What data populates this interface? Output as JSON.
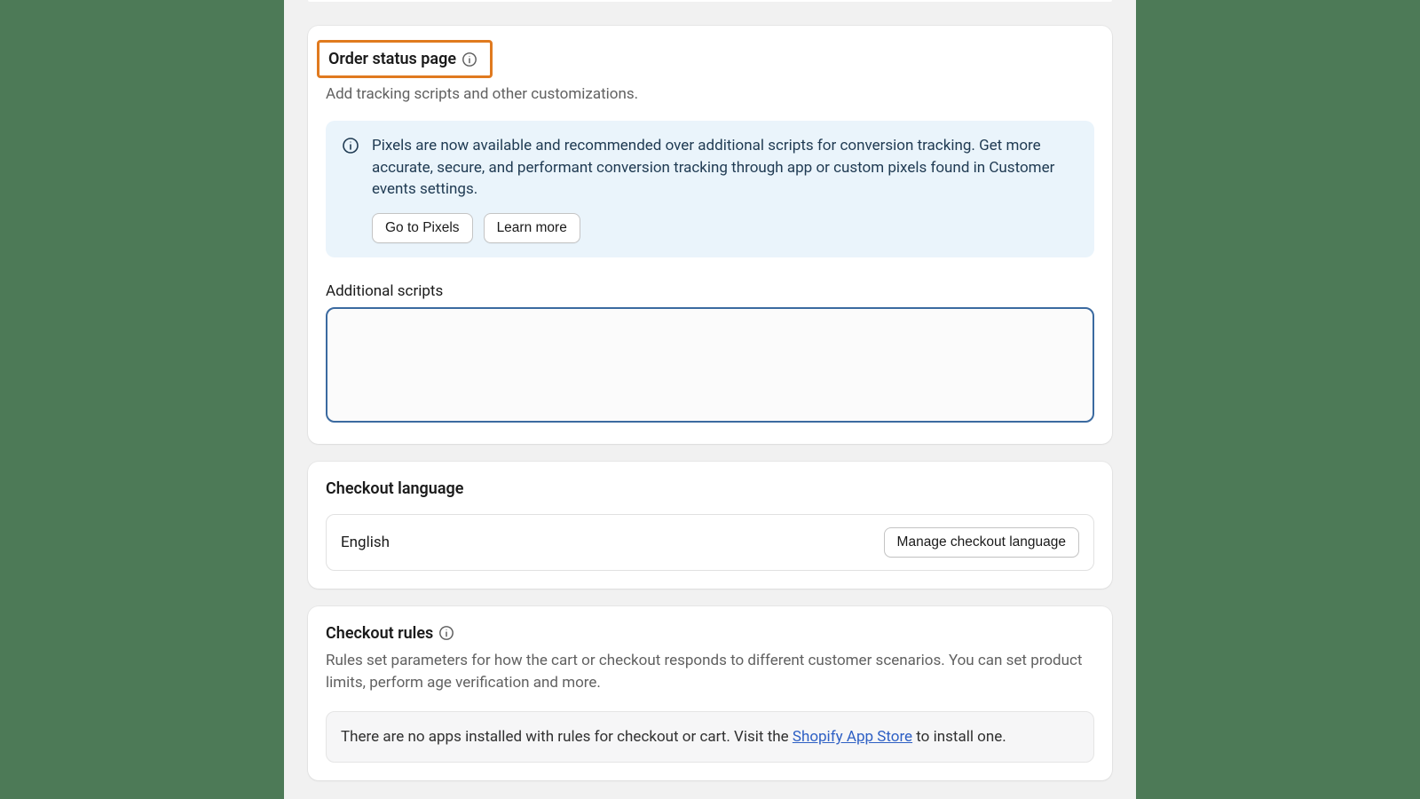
{
  "order_status": {
    "title": "Order status page",
    "subtitle": "Add tracking scripts and other customizations.",
    "banner": {
      "text": "Pixels are now available and recommended over additional scripts for conversion tracking. Get more accurate, secure, and performant conversion tracking through app or custom pixels found in Customer events settings.",
      "go_to_pixels": "Go to Pixels",
      "learn_more": "Learn more"
    },
    "additional_scripts_label": "Additional scripts",
    "additional_scripts_value": ""
  },
  "checkout_language": {
    "title": "Checkout language",
    "value": "English",
    "manage_button": "Manage checkout language"
  },
  "checkout_rules": {
    "title": "Checkout rules",
    "description": "Rules set parameters for how the cart or checkout responds to different customer scenarios. You can set product limits, perform age verification and more.",
    "empty_prefix": "There are no apps installed with rules for checkout or cart. Visit the ",
    "empty_link": "Shopify App Store",
    "empty_suffix": " to install one."
  }
}
